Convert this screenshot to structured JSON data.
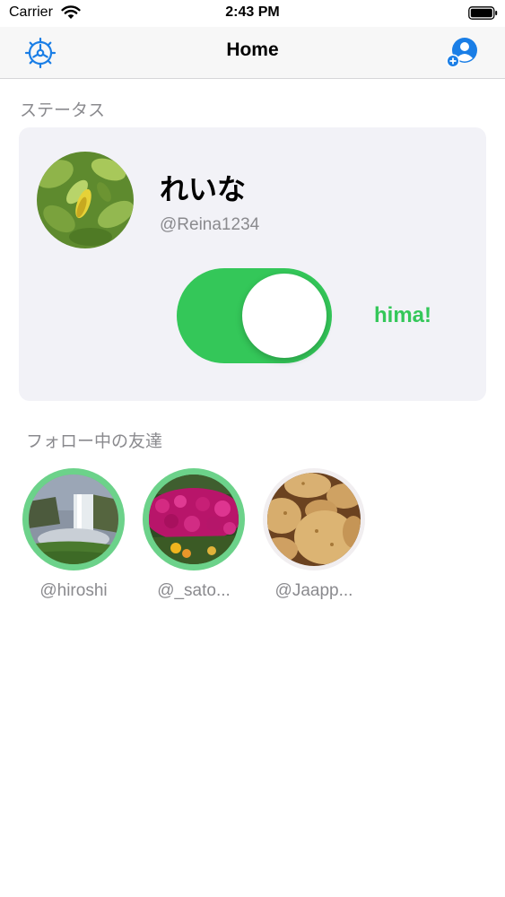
{
  "status_bar": {
    "carrier": "Carrier",
    "time": "2:43 PM"
  },
  "nav": {
    "title": "Home",
    "left_icon": "settings-gear-icon",
    "right_icon": "add-friend-icon",
    "accent_color": "#1a7ee6"
  },
  "status_section": {
    "title": "ステータス",
    "name": "れいな",
    "handle": "@Reina1234",
    "toggle_on": true,
    "status_text": "hima!",
    "status_color": "#34c759"
  },
  "friends_section": {
    "title": "フォロー中の友達",
    "friends": [
      {
        "handle": "@hiroshi",
        "active": true
      },
      {
        "handle": "@_sato...",
        "active": true
      },
      {
        "handle": "@Jaapp...",
        "active": false
      }
    ]
  }
}
